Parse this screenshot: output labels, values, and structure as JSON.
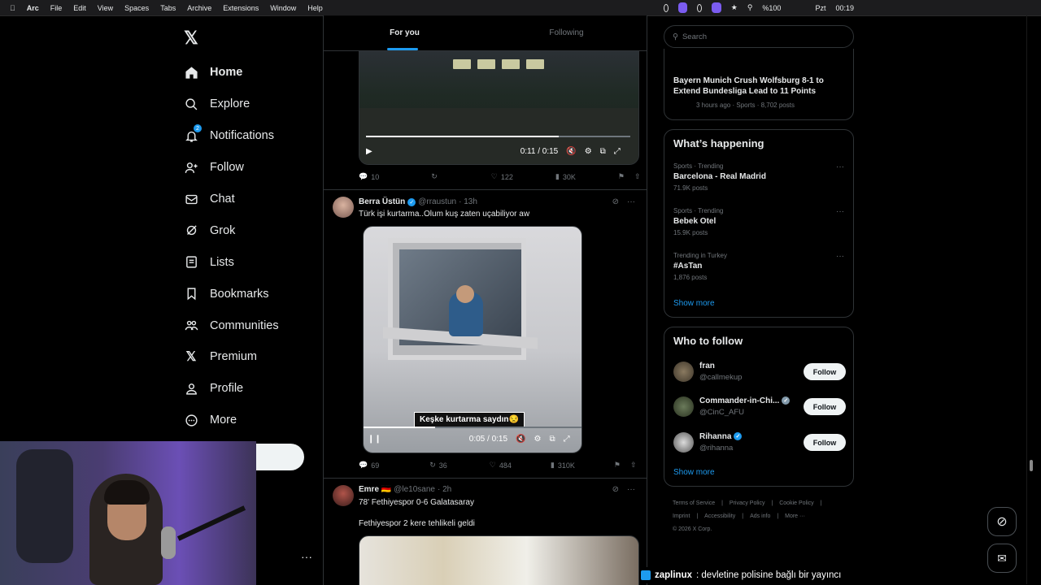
{
  "menubar": {
    "app": "Arc",
    "items": [
      "File",
      "Edit",
      "View",
      "Spaces",
      "Tabs",
      "Archive",
      "Extensions",
      "Window",
      "Help"
    ],
    "battery": "%100",
    "clock_day": "Pzt",
    "clock_time": "00:19"
  },
  "nav": {
    "items": [
      {
        "label": "Home",
        "icon": "home-icon"
      },
      {
        "label": "Explore",
        "icon": "search-icon"
      },
      {
        "label": "Notifications",
        "icon": "bell-icon",
        "badge": "2"
      },
      {
        "label": "Follow",
        "icon": "person-add-icon"
      },
      {
        "label": "Chat",
        "icon": "mail-icon"
      },
      {
        "label": "Grok",
        "icon": "grok-icon"
      },
      {
        "label": "Lists",
        "icon": "list-icon"
      },
      {
        "label": "Bookmarks",
        "icon": "bookmark-icon"
      },
      {
        "label": "Communities",
        "icon": "communities-icon"
      },
      {
        "label": "Premium",
        "icon": "x-icon"
      },
      {
        "label": "Profile",
        "icon": "person-icon"
      },
      {
        "label": "More",
        "icon": "more-circle-icon"
      }
    ]
  },
  "tabs": {
    "for_you": "For you",
    "following": "Following"
  },
  "tweet1": {
    "time": "0:11 / 0:15",
    "progress": 0.73,
    "replies": "10",
    "likes": "122",
    "views": "30K"
  },
  "tweet2": {
    "name": "Berra Üstün",
    "handle": "@rraustun",
    "age": "· 13h",
    "text": "Türk işi kurtarma..Olum kuş zaten uçabiliyor aw",
    "caption": "Keşke kurtarma saydın😒",
    "time": "0:05 / 0:15",
    "progress": 0.33,
    "replies": "69",
    "reposts": "36",
    "likes": "484",
    "views": "310K"
  },
  "tweet3": {
    "name": "Emre 🇩🇪",
    "handle": "@le10sane",
    "age": "· 2h",
    "line1": "78' Fethiyespor 0-6 Galatasaray",
    "line2": "Fethiyespor 2 kere tehlikeli geldi"
  },
  "search": {
    "placeholder": "Search"
  },
  "top_news": {
    "headline": "Bayern Munich Crush Wolfsburg 8-1 to Extend Bundesliga Lead to 11 Points",
    "meta": "3 hours ago · Sports · 8,702 posts"
  },
  "happening": {
    "title": "What’s happening",
    "trends": [
      {
        "meta": "Sports · Trending",
        "name": "Barcelona - Real Madrid",
        "posts": "71.9K posts"
      },
      {
        "meta": "Sports · Trending",
        "name": "Bebek Otel",
        "posts": "15.9K posts"
      },
      {
        "meta": "Trending in Turkey",
        "name": "#AsTan",
        "posts": "1,876 posts"
      }
    ],
    "show_more": "Show more"
  },
  "who_to_follow": {
    "title": "Who to follow",
    "accounts": [
      {
        "name": "fran",
        "handle": "@callmekup",
        "verified": false
      },
      {
        "name": "Commander-in-Chi...",
        "handle": "@CinC_AFU",
        "verified": true
      },
      {
        "name": "Rihanna",
        "handle": "@rihanna",
        "verified": true
      }
    ],
    "follow_label": "Follow",
    "show_more": "Show more"
  },
  "footer": {
    "links": [
      "Terms of Service",
      "Privacy Policy",
      "Cookie Policy",
      "Imprint",
      "Accessibility",
      "Ads info",
      "More ···"
    ],
    "copyright": "© 2026 X Corp."
  },
  "ticker": {
    "user": "zaplinux",
    "message": ": devletine polisine bağlı bir yayıncı"
  },
  "colors": {
    "accent": "#1d9bf0",
    "bg": "#000000",
    "text": "#e7e9ea",
    "muted": "#71767b"
  }
}
